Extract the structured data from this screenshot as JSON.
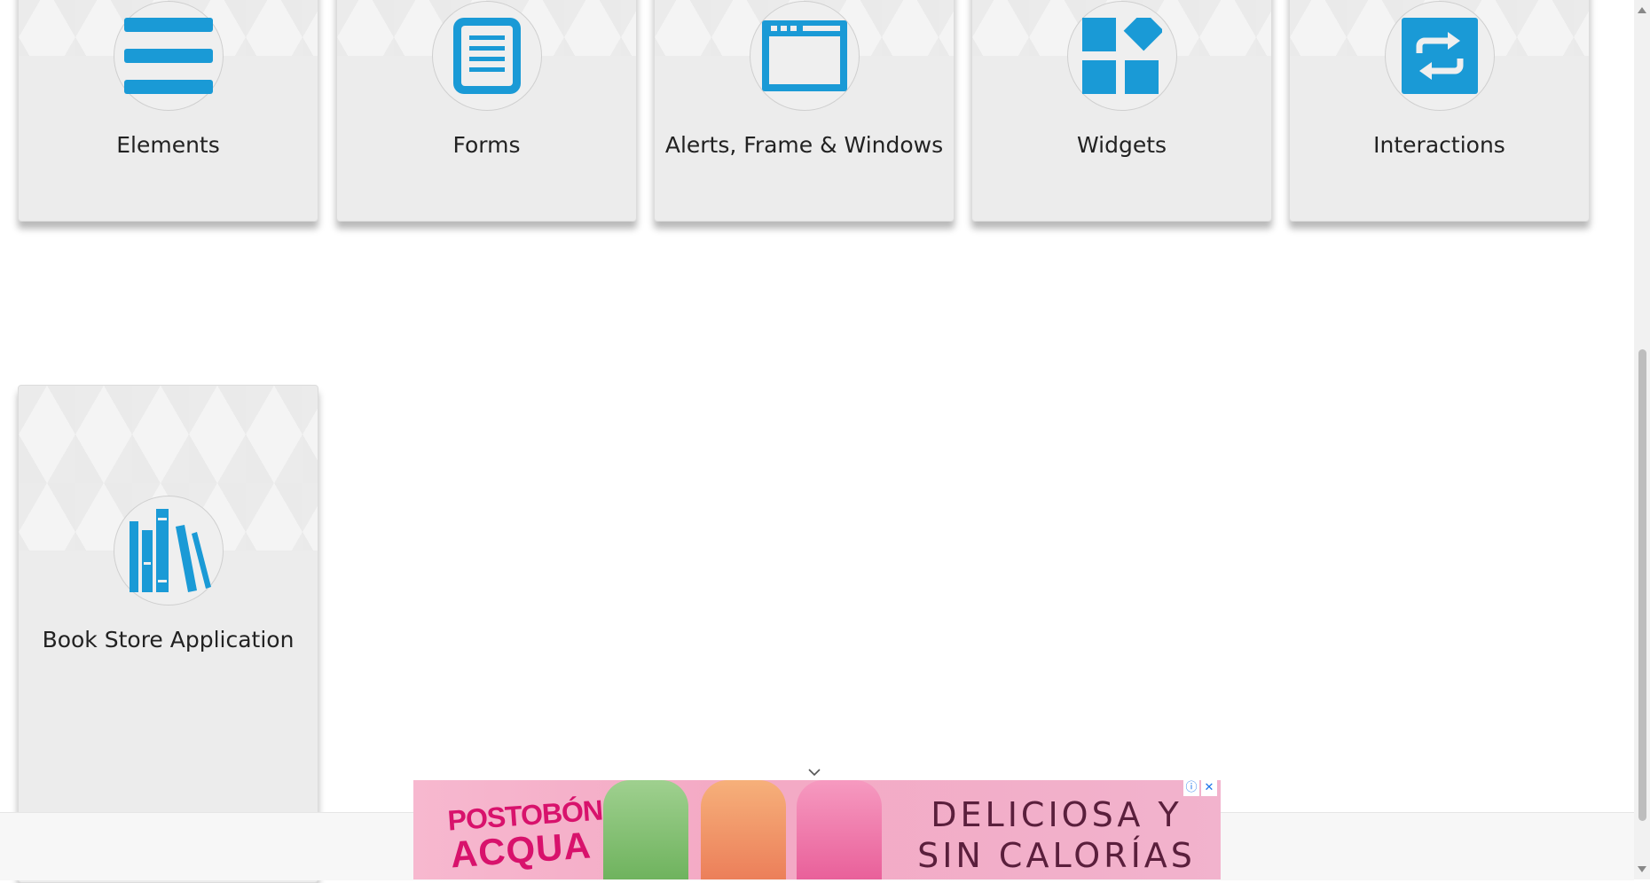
{
  "cards": [
    {
      "label": "Elements",
      "icon": "hamburger-list-icon"
    },
    {
      "label": "Forms",
      "icon": "document-icon"
    },
    {
      "label": "Alerts, Frame & Windows",
      "icon": "browser-window-icon"
    },
    {
      "label": "Widgets",
      "icon": "widgets-blocks-icon"
    },
    {
      "label": "Interactions",
      "icon": "repeat-arrows-icon"
    },
    {
      "label": "Book Store Application",
      "icon": "books-icon"
    }
  ],
  "ad": {
    "brand_line1": "POSTOBÓN",
    "brand_line2": "ACQUA",
    "slogan_line1": "DELICIOSA Y",
    "slogan_line2": "SIN CALORÍAS",
    "info_symbol": "ⓘ",
    "close_symbol": "✕"
  },
  "colors": {
    "icon_blue": "#1a9ad6",
    "card_bg": "#ececec",
    "ad_pink": "#f3a9c4"
  }
}
